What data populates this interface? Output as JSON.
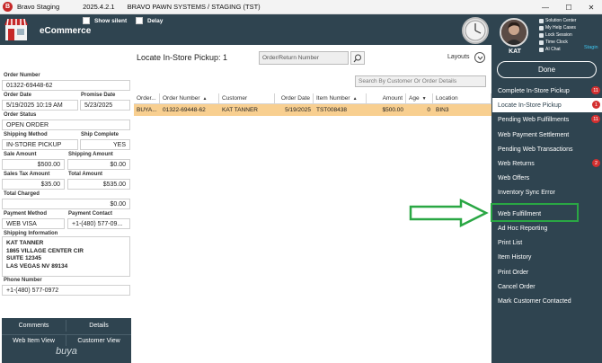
{
  "window": {
    "app_name": "Bravo Staging",
    "version": "2025.4.2.1",
    "system_name": "BRAVO PAWN SYSTEMS / STAGING (TST)",
    "minimize": "—",
    "maximize": "☐",
    "close": "✕"
  },
  "header": {
    "module_title": "eCommerce",
    "show_silent_label": "Show silent",
    "delay_label": "Delay"
  },
  "user": {
    "initials": "KAT",
    "utilities": [
      "Solution Center",
      "My Help Cases",
      "Lock Session",
      "Time Clock",
      "AI Chat"
    ],
    "env_tag": "Stagin"
  },
  "order": {
    "labels": {
      "order_number": "Order Number",
      "order_date": "Order Date",
      "promise_date": "Promise Date",
      "order_status": "Order Status",
      "shipping_method": "Shipping Method",
      "ship_complete": "Ship Complete",
      "sale_amount": "Sale Amount",
      "shipping_amount": "Shipping Amount",
      "sales_tax_amount": "Sales Tax Amount",
      "total_amount": "Total Amount",
      "total_charged": "Total Charged",
      "payment_method": "Payment Method",
      "payment_contact": "Payment Contact",
      "shipping_information": "Shipping Information",
      "phone_number": "Phone Number"
    },
    "order_number": "01322-69448-62",
    "order_date": "5/19/2025 10:19 AM",
    "promise_date": "5/23/2025",
    "order_status": "OPEN ORDER",
    "shipping_method": "IN-STORE PICKUP",
    "ship_complete": "YES",
    "sale_amount": "$500.00",
    "shipping_amount": "$0.00",
    "sales_tax_amount": "$35.00",
    "total_amount": "$535.00",
    "total_charged": "$0.00",
    "payment_method": "WEB VISA",
    "payment_contact": "+1-(480) 577-09...",
    "shipping_lines": [
      "KAT TANNER",
      "1865 VILLAGE CENTER CIR",
      "SUITE 12345",
      "LAS VEGAS NV 89134"
    ],
    "phone_number": "+1-(480) 577-0972"
  },
  "left_buttons": {
    "comments": "Comments",
    "details": "Details",
    "web_item_view": "Web Item View",
    "customer_view": "Customer View",
    "brand": "buya"
  },
  "main": {
    "title": "Locate In-Store Pickup: 1",
    "order_search_placeholder": "Order/Return Number",
    "layouts_label": "Layouts",
    "customer_search_placeholder": "Search By Customer Or Order Details",
    "columns": [
      "Order...",
      "Order Number",
      "Customer",
      "Order Date",
      "Item Number",
      "Amount",
      "Age",
      "Location"
    ],
    "rows": [
      {
        "order_type": "BUYA...",
        "order_number": "01322-69448-62",
        "customer": "KAT TANNER",
        "order_date": "5/19/2025",
        "item_number": "TST008438",
        "amount": "$500.00",
        "age": "0",
        "location": "BIN3"
      }
    ]
  },
  "menu": {
    "done": "Done",
    "items": [
      {
        "label": "Complete In-Store Pickup",
        "badge": "11"
      },
      {
        "label": "Locate In-Store Pickup",
        "badge": "1"
      },
      {
        "label": "Pending Web Fulfillments",
        "badge": "11"
      },
      {
        "label": "Web Payment Settlement",
        "badge": ""
      },
      {
        "label": "Pending Web Transactions",
        "badge": ""
      },
      {
        "label": "Web Returns",
        "badge": "2"
      },
      {
        "label": "Web Offers",
        "badge": ""
      },
      {
        "label": "Inventory Sync Error",
        "badge": ""
      },
      {
        "label": "Web Fulfillment",
        "badge": ""
      },
      {
        "label": "Ad Hoc Reporting",
        "badge": ""
      },
      {
        "label": "Print List",
        "badge": ""
      },
      {
        "label": "Item History",
        "badge": ""
      },
      {
        "label": "Print Order",
        "badge": ""
      },
      {
        "label": "Cancel Order",
        "badge": ""
      },
      {
        "label": "Mark Customer Contacted",
        "badge": ""
      }
    ]
  },
  "colors": {
    "panel": "#2f4450",
    "selected_row": "#f8cf90",
    "badge": "#d32f2f",
    "annotation": "#2aa744"
  }
}
